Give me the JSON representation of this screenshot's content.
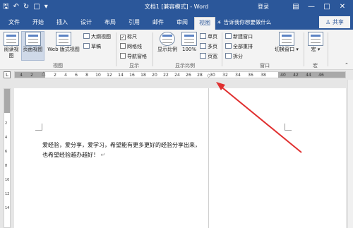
{
  "window": {
    "title": "文档1 [兼容模式] - Word",
    "login": "登录"
  },
  "tabs": [
    {
      "label": "文件",
      "active": false
    },
    {
      "label": "开始",
      "active": false
    },
    {
      "label": "插入",
      "active": false
    },
    {
      "label": "设计",
      "active": false
    },
    {
      "label": "布局",
      "active": false
    },
    {
      "label": "引用",
      "active": false
    },
    {
      "label": "邮件",
      "active": false
    },
    {
      "label": "审阅",
      "active": false
    },
    {
      "label": "视图",
      "active": true
    }
  ],
  "tell_me": "告诉我你想要做什么",
  "share": "共享",
  "ribbon": {
    "views": {
      "read_mode": "阅读视图",
      "print_layout": "页面视图",
      "web_layout": "Web 版式视图",
      "outline": "大纲视图",
      "draft": "草稿",
      "group_label": "视图"
    },
    "show": {
      "ruler": "标尺",
      "gridlines": "网格线",
      "nav_pane": "导航窗格",
      "ruler_checked": true,
      "group_label": "显示"
    },
    "zoom": {
      "zoom": "显示比例",
      "hundred": "100%",
      "one_page": "单页",
      "multi_page": "多页",
      "page_width": "页宽",
      "group_label": "显示比例"
    },
    "window": {
      "new_window": "新建窗口",
      "arrange_all": "全部重排",
      "split": "拆分",
      "switch_windows": "切换窗口",
      "group_label": "窗口"
    },
    "macros": {
      "macros": "宏",
      "group_label": "宏"
    }
  },
  "ruler_labels": [
    "4",
    "2",
    "2",
    "4",
    "6",
    "8",
    "10",
    "12",
    "14",
    "16",
    "18",
    "20",
    "22",
    "24",
    "26",
    "28",
    "30",
    "32",
    "34",
    "36",
    "38",
    "40",
    "42",
    "44",
    "46"
  ],
  "vruler_labels": [
    "2",
    "4",
    "6",
    "8",
    "10",
    "12",
    "14"
  ],
  "document": {
    "line1": "爱经验，爱分享，爱学习，希望能有更多更好的经验分享出来，",
    "line2": "也希望经验越办越好！"
  },
  "colors": {
    "accent": "#2b579a",
    "arrow": "#e03030"
  }
}
